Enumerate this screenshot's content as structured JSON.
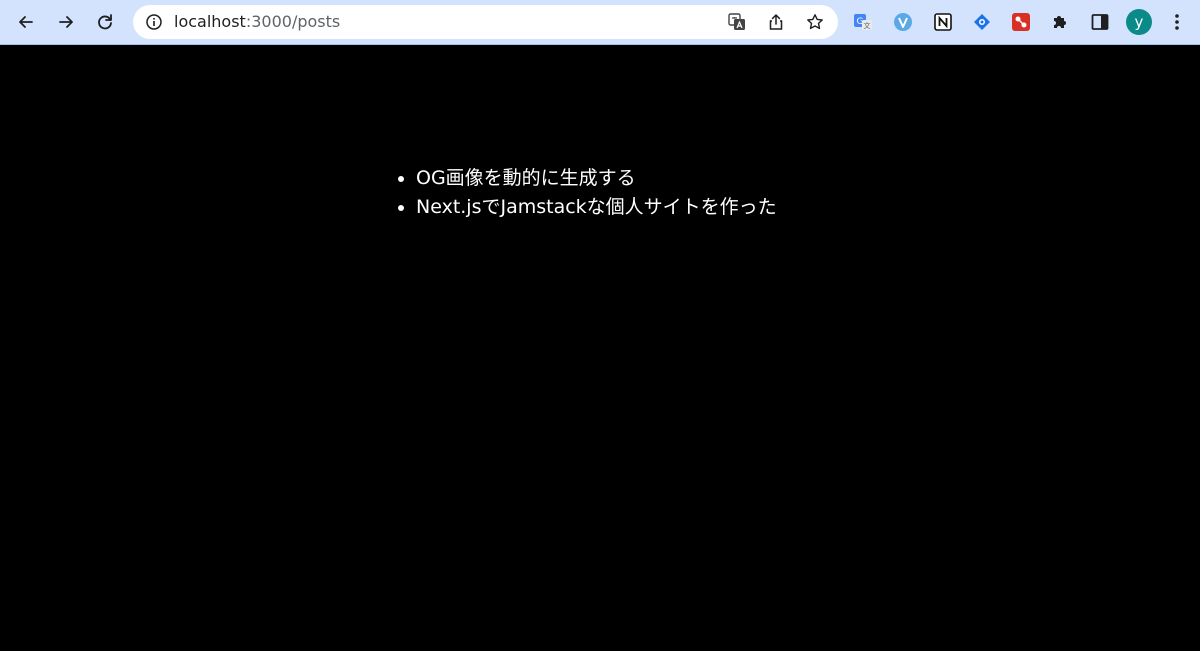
{
  "browser": {
    "url_host": "localhost",
    "url_path": ":3000/posts",
    "avatar_letter": "y",
    "icons": [
      "back-arrow-icon",
      "forward-arrow-icon",
      "reload-icon",
      "info-icon",
      "translate-icon",
      "share-icon",
      "star-icon",
      "google-translate-extension-icon",
      "v-extension-icon",
      "notion-extension-icon",
      "diamond-extension-icon",
      "red-extension-icon",
      "puzzle-icon",
      "side-panel-icon",
      "kebab-menu-icon"
    ]
  },
  "posts": [
    {
      "title": "OG画像を動的に生成する"
    },
    {
      "title": "Next.jsでJamstackな個人サイトを作った"
    }
  ]
}
